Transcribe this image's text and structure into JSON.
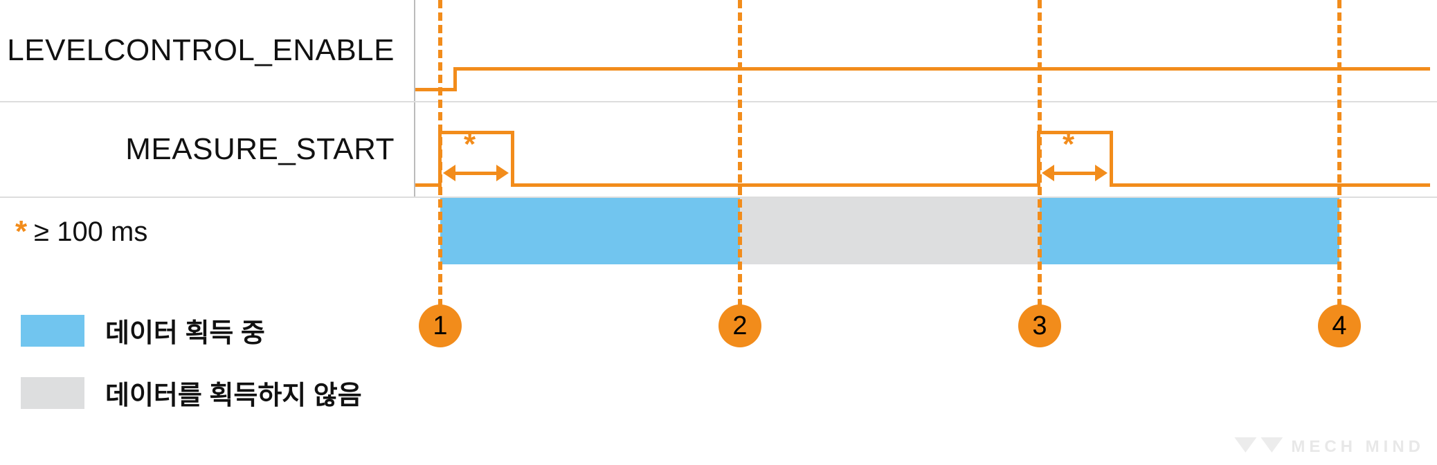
{
  "signals": {
    "levelcontrol_enable": {
      "label": "LEVELCONTROL_ENABLE"
    },
    "measure_start": {
      "label": "MEASURE_START"
    }
  },
  "note": {
    "star": "*",
    "text": "≥ 100 ms"
  },
  "legend": {
    "acquiring": "데이터 획득 중",
    "not_acquiring": "데이터를 획득하지 않음"
  },
  "markers": [
    "1",
    "2",
    "3",
    "4"
  ],
  "pulse_annotation": "*",
  "watermark": "MECH MIND",
  "chart_data": {
    "type": "timing-diagram",
    "time_axis_units": "arbitrary",
    "markers": [
      {
        "id": 1,
        "t": 0
      },
      {
        "id": 2,
        "t": 100
      },
      {
        "id": 3,
        "t": 200
      },
      {
        "id": 4,
        "t": 300
      }
    ],
    "signals": [
      {
        "name": "LEVELCONTROL_ENABLE",
        "segments": [
          {
            "from": -10,
            "to": 3,
            "level": "low"
          },
          {
            "from": 3,
            "to": 300,
            "level": "high"
          }
        ]
      },
      {
        "name": "MEASURE_START",
        "segments": [
          {
            "from": -10,
            "to": 0,
            "level": "low"
          },
          {
            "from": 0,
            "to": 25,
            "level": "high",
            "min_width_note": "≥ 100 ms"
          },
          {
            "from": 25,
            "to": 200,
            "level": "low"
          },
          {
            "from": 200,
            "to": 225,
            "level": "high",
            "min_width_note": "≥ 100 ms"
          },
          {
            "from": 225,
            "to": 300,
            "level": "low"
          }
        ]
      }
    ],
    "acquisition_state": [
      {
        "from": 0,
        "to": 100,
        "state": "acquiring"
      },
      {
        "from": 100,
        "to": 200,
        "state": "not_acquiring"
      },
      {
        "from": 200,
        "to": 300,
        "state": "acquiring"
      }
    ],
    "legend": {
      "acquiring": "데이터 획득 중",
      "not_acquiring": "데이터를 획득하지 않음"
    }
  }
}
